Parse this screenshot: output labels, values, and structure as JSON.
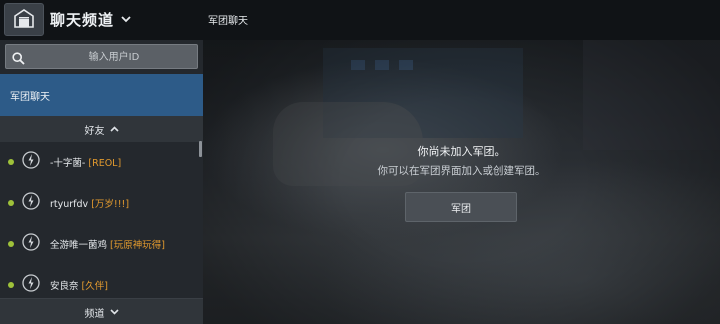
{
  "header": {
    "home_icon": "hangar-icon",
    "title": "聊天频道",
    "chat_title": "军团聊天"
  },
  "sidebar": {
    "search": {
      "placeholder": "输入用户ID",
      "value": ""
    },
    "clan_chat_label": "军团聊天",
    "friends_label": "好友",
    "channels_label": "频道",
    "friends": [
      {
        "name": "-十字菌-",
        "clan": "[REOL]",
        "status": "online"
      },
      {
        "name": "rtyurfdv",
        "clan": "[万岁!!!]",
        "status": "online"
      },
      {
        "name": "全游唯一菌鸡",
        "clan": "[玩原神玩得]",
        "status": "online"
      },
      {
        "name": "安良奈",
        "clan": "[久伴]",
        "status": "online"
      }
    ]
  },
  "main": {
    "message_line1": "你尚未加入军团。",
    "message_line2": "你可以在军团界面加入或创建军团。",
    "clan_button_label": "军团"
  },
  "colors": {
    "accent": "#2d5b88",
    "online": "#9fc23a",
    "clan_tag": "#e29a2e"
  }
}
